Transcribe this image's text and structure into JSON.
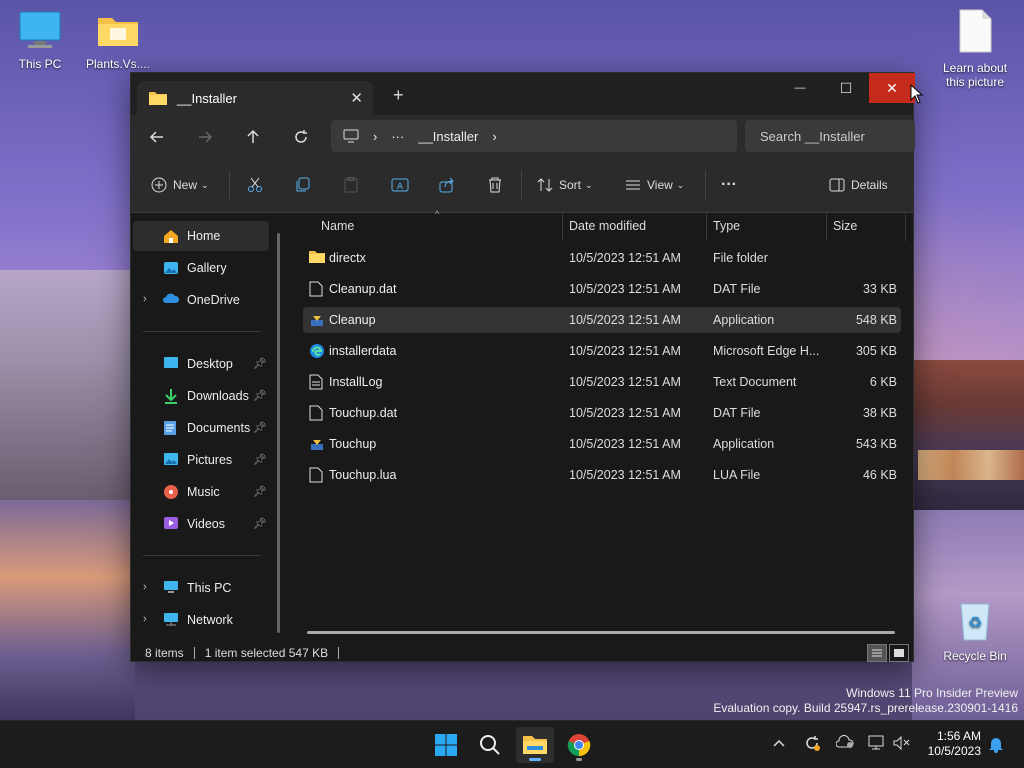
{
  "desktop": {
    "icons": [
      {
        "label": "This PC"
      },
      {
        "label": "Plants.Vs...."
      },
      {
        "label": "Learn about this picture"
      },
      {
        "label": "Recycle Bin"
      }
    ],
    "watermark": {
      "line1": "Windows 11 Pro Insider Preview",
      "line2": "Evaluation copy. Build 25947.rs_prerelease.230901-1416"
    }
  },
  "window": {
    "tab_title": "__Installer",
    "close_tab": "✕",
    "new_tab": "+",
    "controls": {
      "minimize": "—",
      "maximize": "☐",
      "close": "✕"
    },
    "address": {
      "more": "···",
      "crumb": "__Installer"
    },
    "search_placeholder": "Search __Installer",
    "toolbar": {
      "new_label": "New",
      "sort_label": "Sort",
      "view_label": "View",
      "more_label": "···",
      "details_label": "Details"
    },
    "sidebar": {
      "items": [
        {
          "label": "Home",
          "icon": "home-icon"
        },
        {
          "label": "Gallery",
          "icon": "gallery-icon"
        },
        {
          "label": "OneDrive",
          "icon": "onedrive-icon"
        },
        {
          "label": "Desktop",
          "icon": "desktop-icon"
        },
        {
          "label": "Downloads",
          "icon": "downloads-icon"
        },
        {
          "label": "Documents",
          "icon": "documents-icon"
        },
        {
          "label": "Pictures",
          "icon": "pictures-icon"
        },
        {
          "label": "Music",
          "icon": "music-icon"
        },
        {
          "label": "Videos",
          "icon": "videos-icon"
        },
        {
          "label": "This PC",
          "icon": "this-pc-icon"
        },
        {
          "label": "Network",
          "icon": "network-icon"
        }
      ]
    },
    "columns": {
      "name": "Name",
      "date": "Date modified",
      "type": "Type",
      "size": "Size"
    },
    "files": [
      {
        "name": "directx",
        "date": "10/5/2023 12:51 AM",
        "type": "File folder",
        "size": "",
        "icon": "folder-icon"
      },
      {
        "name": "Cleanup.dat",
        "date": "10/5/2023 12:51 AM",
        "type": "DAT File",
        "size": "33 KB",
        "icon": "file-icon"
      },
      {
        "name": "Cleanup",
        "date": "10/5/2023 12:51 AM",
        "type": "Application",
        "size": "548 KB",
        "icon": "application-icon"
      },
      {
        "name": "installerdata",
        "date": "10/5/2023 12:51 AM",
        "type": "Microsoft Edge H...",
        "size": "305 KB",
        "icon": "edge-icon"
      },
      {
        "name": "InstallLog",
        "date": "10/5/2023 12:51 AM",
        "type": "Text Document",
        "size": "6 KB",
        "icon": "text-document-icon"
      },
      {
        "name": "Touchup.dat",
        "date": "10/5/2023 12:51 AM",
        "type": "DAT File",
        "size": "38 KB",
        "icon": "file-icon"
      },
      {
        "name": "Touchup",
        "date": "10/5/2023 12:51 AM",
        "type": "Application",
        "size": "543 KB",
        "icon": "application-icon"
      },
      {
        "name": "Touchup.lua",
        "date": "10/5/2023 12:51 AM",
        "type": "LUA File",
        "size": "46 KB",
        "icon": "file-icon"
      }
    ],
    "status": {
      "items": "8 items",
      "selected": "1 item selected  547 KB"
    }
  },
  "taskbar": {
    "time": "1:56 AM",
    "date": "10/5/2023"
  },
  "colors": {
    "accent": "#60b4ff",
    "close_red": "#c42b1c",
    "window_bg": "#191919",
    "toolbar_bg": "#2b2b2b"
  }
}
